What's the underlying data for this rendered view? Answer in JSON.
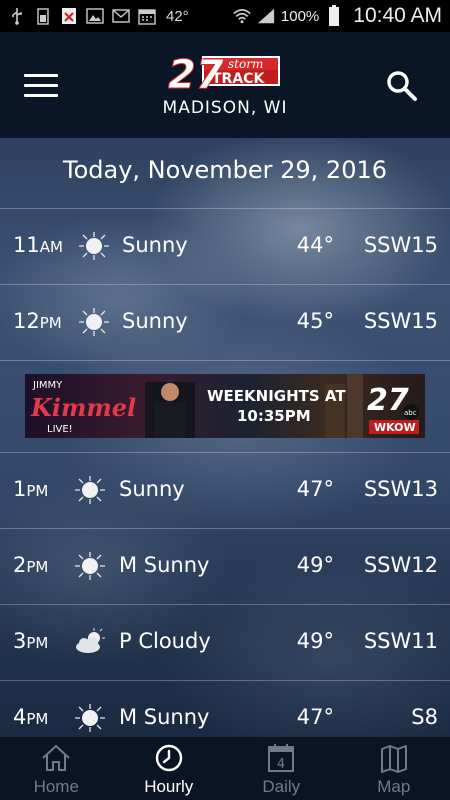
{
  "status_bar": {
    "temperature": "42°",
    "battery_pct": "100%",
    "time": "10:40 AM",
    "icons": [
      "usb-icon",
      "battery-100-icon",
      "blocked-icon",
      "gallery-icon",
      "gmail-icon",
      "calendar-icon"
    ]
  },
  "header": {
    "logo": {
      "number": "27",
      "word1": "storm",
      "word2": "TRACK"
    },
    "location": "MADISON, WI"
  },
  "main": {
    "date_title": "Today, November 29, 2016",
    "rows_top": [
      {
        "hour": "11",
        "ampm": "AM",
        "icon": "sun-icon",
        "condition": "Sunny",
        "temp": "44°",
        "wind": "SSW15"
      },
      {
        "hour": "12",
        "ampm": "PM",
        "icon": "sun-icon",
        "condition": "Sunny",
        "temp": "45°",
        "wind": "SSW15"
      }
    ],
    "ad": {
      "line1": "JIMMY",
      "line2": "Kimmel",
      "line3": "LIVE!",
      "promo1": "WEEKNIGHTS AT",
      "promo2": "10:35PM",
      "channel": "27",
      "network": "abc",
      "callsign": "WKOW"
    },
    "rows_bottom": [
      {
        "hour": "1",
        "ampm": "PM",
        "icon": "sun-icon",
        "condition": "Sunny",
        "temp": "47°",
        "wind": "SSW13"
      },
      {
        "hour": "2",
        "ampm": "PM",
        "icon": "sun-icon",
        "condition": "M Sunny",
        "temp": "49°",
        "wind": "SSW12"
      },
      {
        "hour": "3",
        "ampm": "PM",
        "icon": "partly-cloudy-icon",
        "condition": "P Cloudy",
        "temp": "49°",
        "wind": "SSW11"
      },
      {
        "hour": "4",
        "ampm": "PM",
        "icon": "sun-icon",
        "condition": "M Sunny",
        "temp": "47°",
        "wind": "S8"
      }
    ]
  },
  "bottom_nav": {
    "items": [
      {
        "label": "Home",
        "icon": "home-icon",
        "active": false
      },
      {
        "label": "Hourly",
        "icon": "clock-icon",
        "active": true
      },
      {
        "label": "Daily",
        "icon": "calendar-icon",
        "badge": "4",
        "active": false
      },
      {
        "label": "Map",
        "icon": "map-icon",
        "active": false
      }
    ]
  },
  "colors": {
    "active_nav": "#ffffff",
    "inactive_nav": "#6f7a8a",
    "logo_red": "#d62a2a"
  }
}
